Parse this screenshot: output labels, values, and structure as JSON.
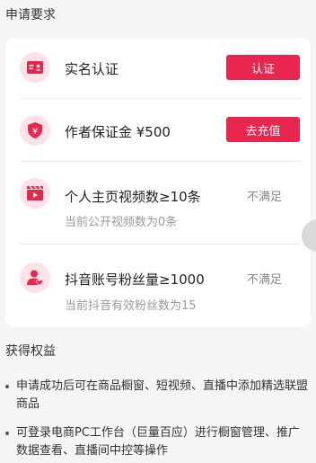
{
  "requirements": {
    "title": "申请要求",
    "items": [
      {
        "icon": "id-card-icon",
        "title": "实名认证",
        "button": "认证"
      },
      {
        "icon": "shield-yen-icon",
        "title": "作者保证金 ¥500",
        "button": "去充值"
      },
      {
        "icon": "video-clapper-icon",
        "title": "个人主页视频数≥10条",
        "subtitle": "当前公开视频数为0条",
        "status": "不满足"
      },
      {
        "icon": "fans-user-heart-icon",
        "title": "抖音账号粉丝量≥1000",
        "subtitle": "当前抖音有效粉丝数为15",
        "status": "不满足"
      }
    ]
  },
  "benefits": {
    "title": "获得权益",
    "items": [
      "申请成功后可在商品橱窗、短视频、直播中添加精选联盟商品",
      "可登录电商PC工作台（巨量百应）进行橱窗管理、推广数据查看、直播间中控等操作"
    ]
  },
  "colors": {
    "accent": "#e8264e",
    "icon_bg": "#fde3e8"
  }
}
